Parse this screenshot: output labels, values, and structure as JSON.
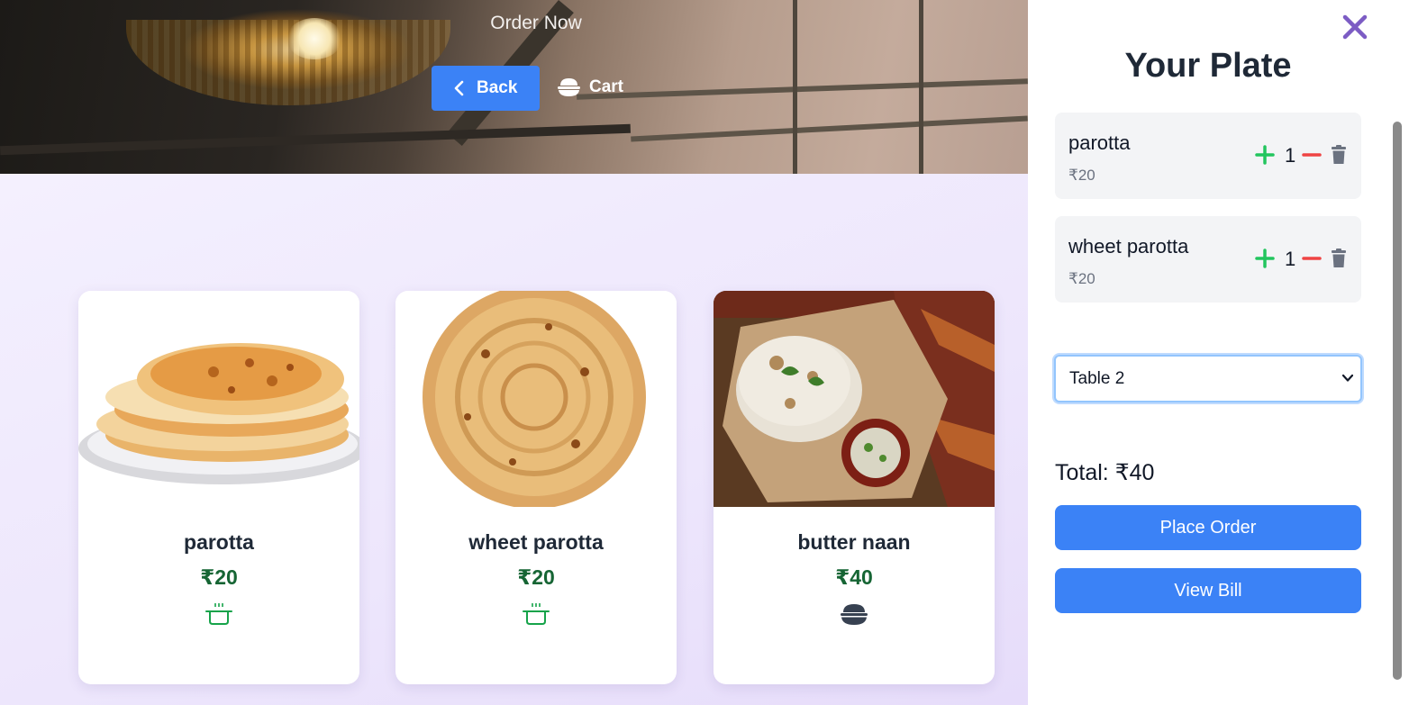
{
  "header": {
    "title": "Order Now",
    "back_label": "Back",
    "cart_label": "Cart"
  },
  "products": [
    {
      "name": "parotta",
      "price": "₹20",
      "icon": "pot-icon",
      "image": "parotta-stack-image"
    },
    {
      "name": "wheet parotta",
      "price": "₹20",
      "icon": "pot-icon",
      "image": "wheet-parotta-image"
    },
    {
      "name": "butter naan",
      "price": "₹40",
      "icon": "rice-bowl-icon",
      "image": "butter-naan-image"
    }
  ],
  "plate": {
    "title": "Your Plate",
    "items": [
      {
        "name": "parotta",
        "price": "₹20",
        "qty": "1"
      },
      {
        "name": "wheet parotta",
        "price": "₹20",
        "qty": "1"
      }
    ],
    "table_selected": "Table 2",
    "total": "Total: ₹40",
    "place_order_label": "Place Order",
    "view_bill_label": "View Bill"
  },
  "colors": {
    "accent": "#3b82f6",
    "price_green": "#166534",
    "plus_green": "#22c55e",
    "minus_red": "#ef4444",
    "close_purple": "#7c5cc4"
  }
}
